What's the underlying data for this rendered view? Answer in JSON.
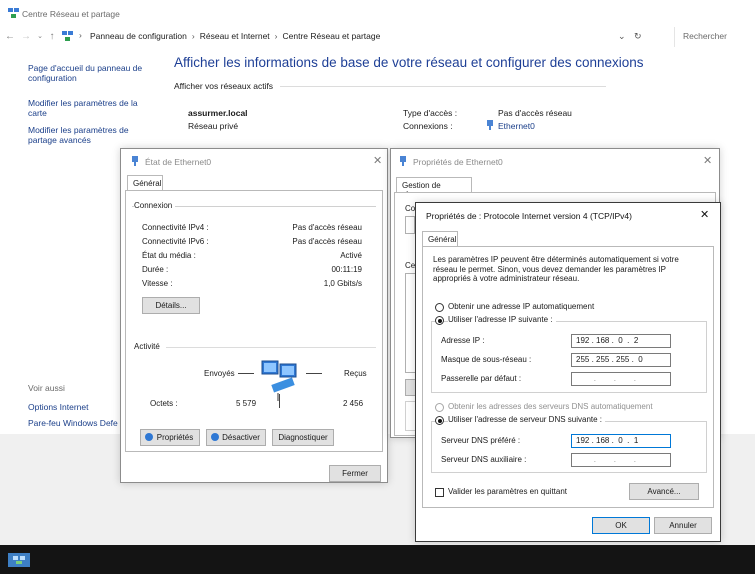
{
  "window": {
    "title": "Centre Réseau et partage",
    "breadcrumbs": [
      "Panneau de configuration",
      "Réseau et Internet",
      "Centre Réseau et partage"
    ],
    "search_placeholder": "Rechercher"
  },
  "sidebar": {
    "links": [
      "Page d'accueil du panneau de configuration",
      "Modifier les paramètres de la carte",
      "Modifier les paramètres de partage avancés"
    ],
    "see_also_label": "Voir aussi",
    "see_also": [
      "Options Internet",
      "Pare-feu Windows Defe"
    ]
  },
  "main": {
    "headline": "Afficher les informations de base de votre réseau et configurer des connexions",
    "active_networks_label": "Afficher vos réseaux actifs",
    "network_name": "assurmer.local",
    "network_type": "Réseau privé",
    "access_type_label": "Type d'accès :",
    "access_type_value": "Pas d'accès réseau",
    "connections_label": "Connexions :",
    "connections_value": "Ethernet0"
  },
  "status_dialog": {
    "title": "État de Ethernet0",
    "tab": "Général",
    "connection_group": "Connexion",
    "rows": [
      {
        "label": "Connectivité IPv4 :",
        "value": "Pas d'accès réseau"
      },
      {
        "label": "Connectivité IPv6 :",
        "value": "Pas d'accès réseau"
      },
      {
        "label": "État du média :",
        "value": "Activé"
      },
      {
        "label": "Durée :",
        "value": "00:11:19"
      },
      {
        "label": "Vitesse :",
        "value": "1,0 Gbits/s"
      }
    ],
    "details_button": "Détails...",
    "activity_group": "Activité",
    "sent_label": "Envoyés",
    "received_label": "Reçus",
    "bytes_label": "Octets :",
    "bytes_sent": "5 579",
    "bytes_received": "2 456",
    "properties_button": "Propriétés",
    "disable_button": "Désactiver",
    "diagnose_button": "Diagnostiquer",
    "close_button": "Fermer"
  },
  "props_dialog": {
    "title": "Propriétés de Ethernet0",
    "tab": "Gestion de réseau",
    "frag_co": "Co",
    "frag_ce": "Ce"
  },
  "ipv4_dialog": {
    "title": "Propriétés de : Protocole Internet version 4 (TCP/IPv4)",
    "tab": "Général",
    "description": "Les paramètres IP peuvent être déterminés automatiquement si votre réseau le permet. Sinon, vous devez demander les paramètres IP appropriés à votre administrateur réseau.",
    "auto_ip_label": "Obtenir une adresse IP automatiquement",
    "manual_ip_label": "Utiliser l'adresse IP suivante :",
    "ip_label": "Adresse IP :",
    "ip_value": "192 . 168 .  0  .  2",
    "mask_label": "Masque de sous-réseau :",
    "mask_value": "255 . 255 . 255 .  0",
    "gateway_label": "Passerelle par défaut :",
    "gateway_value": "        .        .        .",
    "auto_dns_label": "Obtenir les adresses des serveurs DNS automatiquement",
    "manual_dns_label": "Utiliser l'adresse de serveur DNS suivante :",
    "dns_pref_label": "Serveur DNS préféré :",
    "dns_pref_value": "192 . 168 .  0  .  1",
    "dns_alt_label": "Serveur DNS auxiliaire :",
    "dns_alt_value": "        .        .        .",
    "validate_label": "Valider les paramètres en quittant",
    "advanced_button": "Avancé...",
    "ok_button": "OK",
    "cancel_button": "Annuler"
  },
  "colors": {
    "link": "#1b3f8a",
    "headline": "#1e3f96",
    "taskbar": "#141414",
    "accent": "#0078d7"
  }
}
